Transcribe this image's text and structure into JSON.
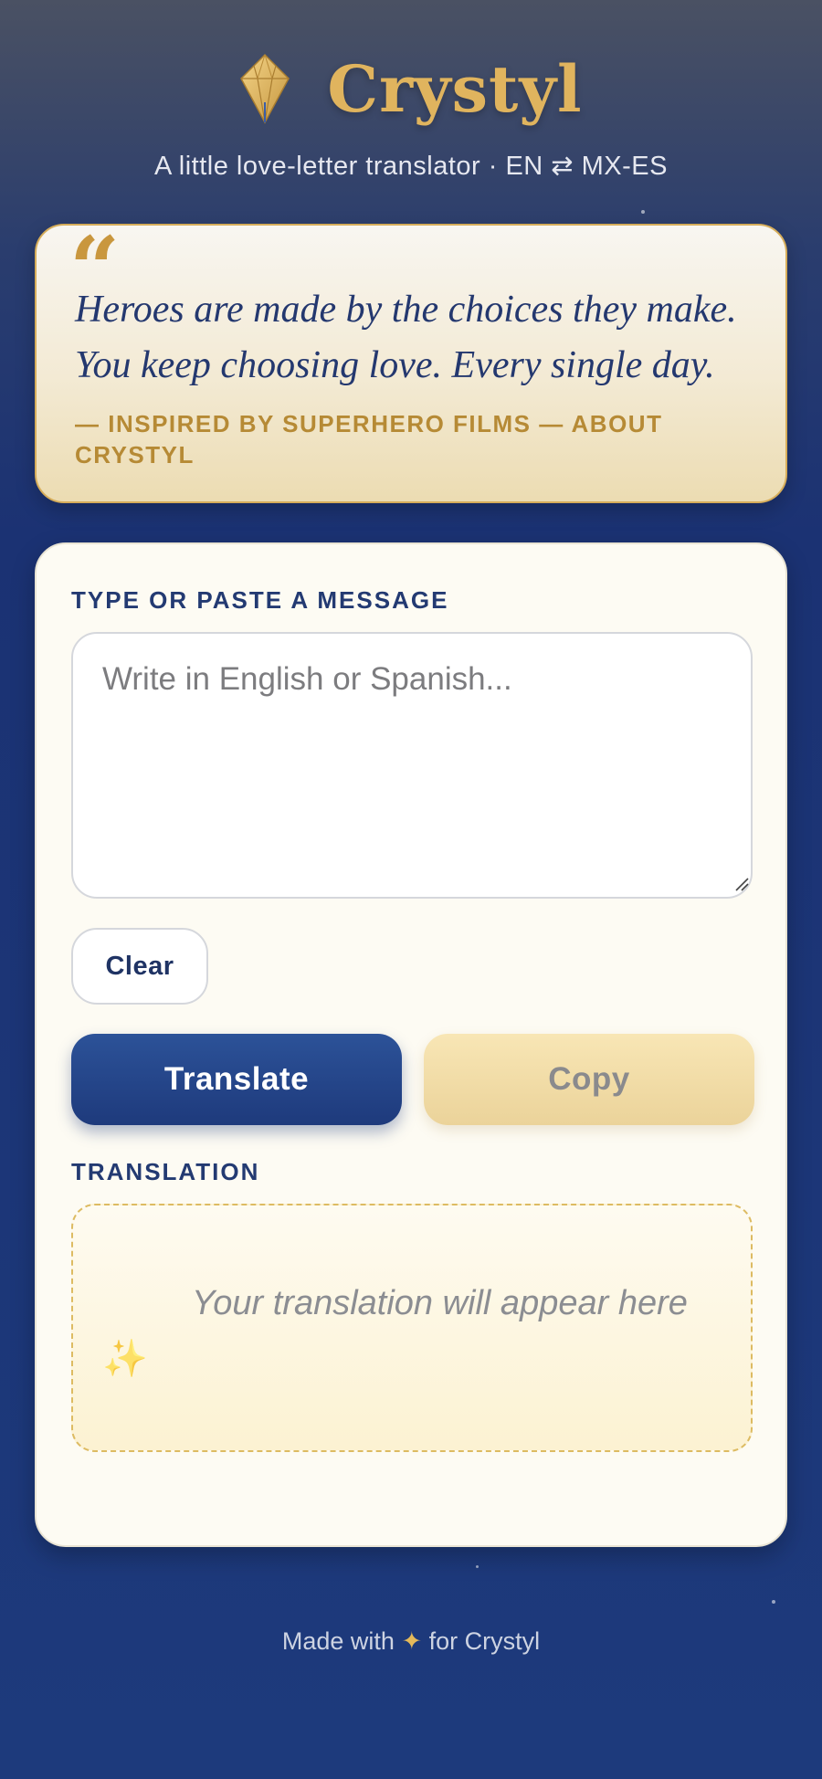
{
  "app": {
    "title": "Crystyl",
    "subtitle": "A little love-letter translator · EN ⇄ MX-ES",
    "logo_icon": "diamond-gem-icon"
  },
  "quote": {
    "mark": "“",
    "text": "Heroes are made by the choices they make. You keep choosing love. Every single day.",
    "attribution": "— Inspired by superhero films — about Crystyl"
  },
  "input": {
    "label": "TYPE OR PASTE A MESSAGE",
    "placeholder": "Write in English or Spanish...",
    "value": ""
  },
  "buttons": {
    "clear": "Clear",
    "translate": "Translate",
    "copy": "Copy"
  },
  "output": {
    "label": "TRANSLATION",
    "placeholder": "Your translation will appear here",
    "sparkle_icon": "sparkles-icon",
    "sparkle_glyph": "✨"
  },
  "footer": {
    "prefix": "Made with",
    "symbol": "✦",
    "suffix": "for Crystyl"
  },
  "colors": {
    "navy": "#1d3a7c",
    "gold": "#e0b45e",
    "card_bg": "#fdfbf3"
  }
}
